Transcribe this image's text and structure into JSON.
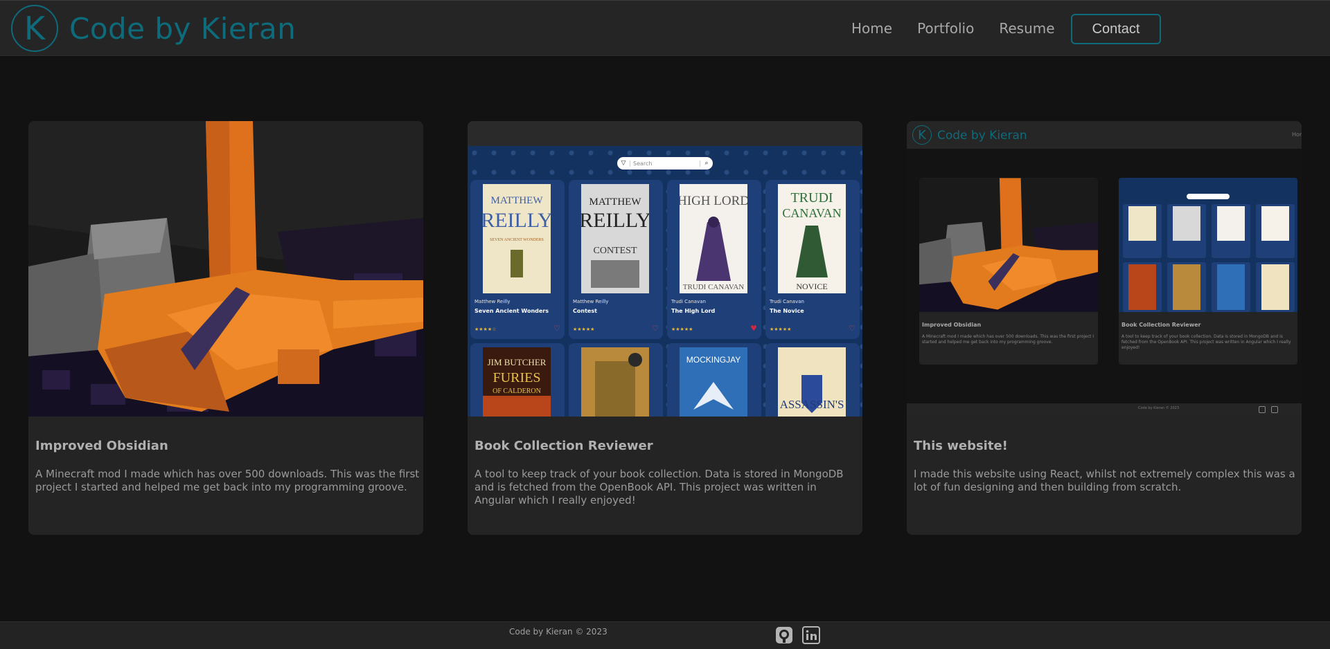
{
  "brand": {
    "logo_letter": "K",
    "name": "Code by Kieran"
  },
  "nav": {
    "links": [
      "Home",
      "Portfolio",
      "Resume"
    ],
    "contact_label": "Contact"
  },
  "projects": [
    {
      "title": "Improved Obsidian",
      "description": "A Minecraft mod I made which has over 500 downloads. This was the first project I started and helped me get back into my programming groove."
    },
    {
      "title": "Book Collection Reviewer",
      "description": "A tool to keep track of your book collection. Data is stored in MongoDB and is fetched from the OpenBook API. This project was written in Angular which I really enjoyed!"
    },
    {
      "title": "This website!",
      "description": "I made this website using React, whilst not extremely complex this was a lot of fun designing and then building from scratch."
    }
  ],
  "book_app": {
    "search_placeholder": "Search",
    "books": [
      {
        "author": "Matthew Reilly",
        "title": "Seven Ancient Wonders",
        "cover_top": "MATTHEW REILLY",
        "cover_sub": "SEVEN ANCIENT WONDERS",
        "stars": "★★★★☆",
        "liked": false
      },
      {
        "author": "Matthew Reilly",
        "title": "Contest",
        "cover_top": "MATTHEW REILLY",
        "cover_sub": "CONTEST",
        "stars": "★★★★★",
        "liked": false
      },
      {
        "author": "Trudi Canavan",
        "title": "The High Lord",
        "cover_top": "THE HIGH LORD",
        "cover_sub": "TRUDI CANAVAN",
        "stars": "★★★★★",
        "liked": true
      },
      {
        "author": "Trudi Canavan",
        "title": "The Novice",
        "cover_top": "TRUDI CANAVAN",
        "cover_sub": "THE NOVICE",
        "stars": "★★★★★",
        "liked": false
      }
    ],
    "second_row_covers": [
      "JIM BUTCHER FURIES OF CALDERON",
      "",
      "MOCKINGJAY",
      "ASSASSIN'S"
    ]
  },
  "site_preview": {
    "home_label": "Hom",
    "card_titles": [
      "Improved Obsidian",
      "Book Collection Reviewer"
    ],
    "footer_text": "Code by Kieran © 2023"
  },
  "footer": {
    "text": "Code by Kieran © 2023",
    "icons": [
      "github-icon",
      "linkedin-icon"
    ]
  },
  "colors": {
    "accent": "#0e6b7c",
    "background": "#121212",
    "card": "#242424",
    "nav": "#252525"
  }
}
